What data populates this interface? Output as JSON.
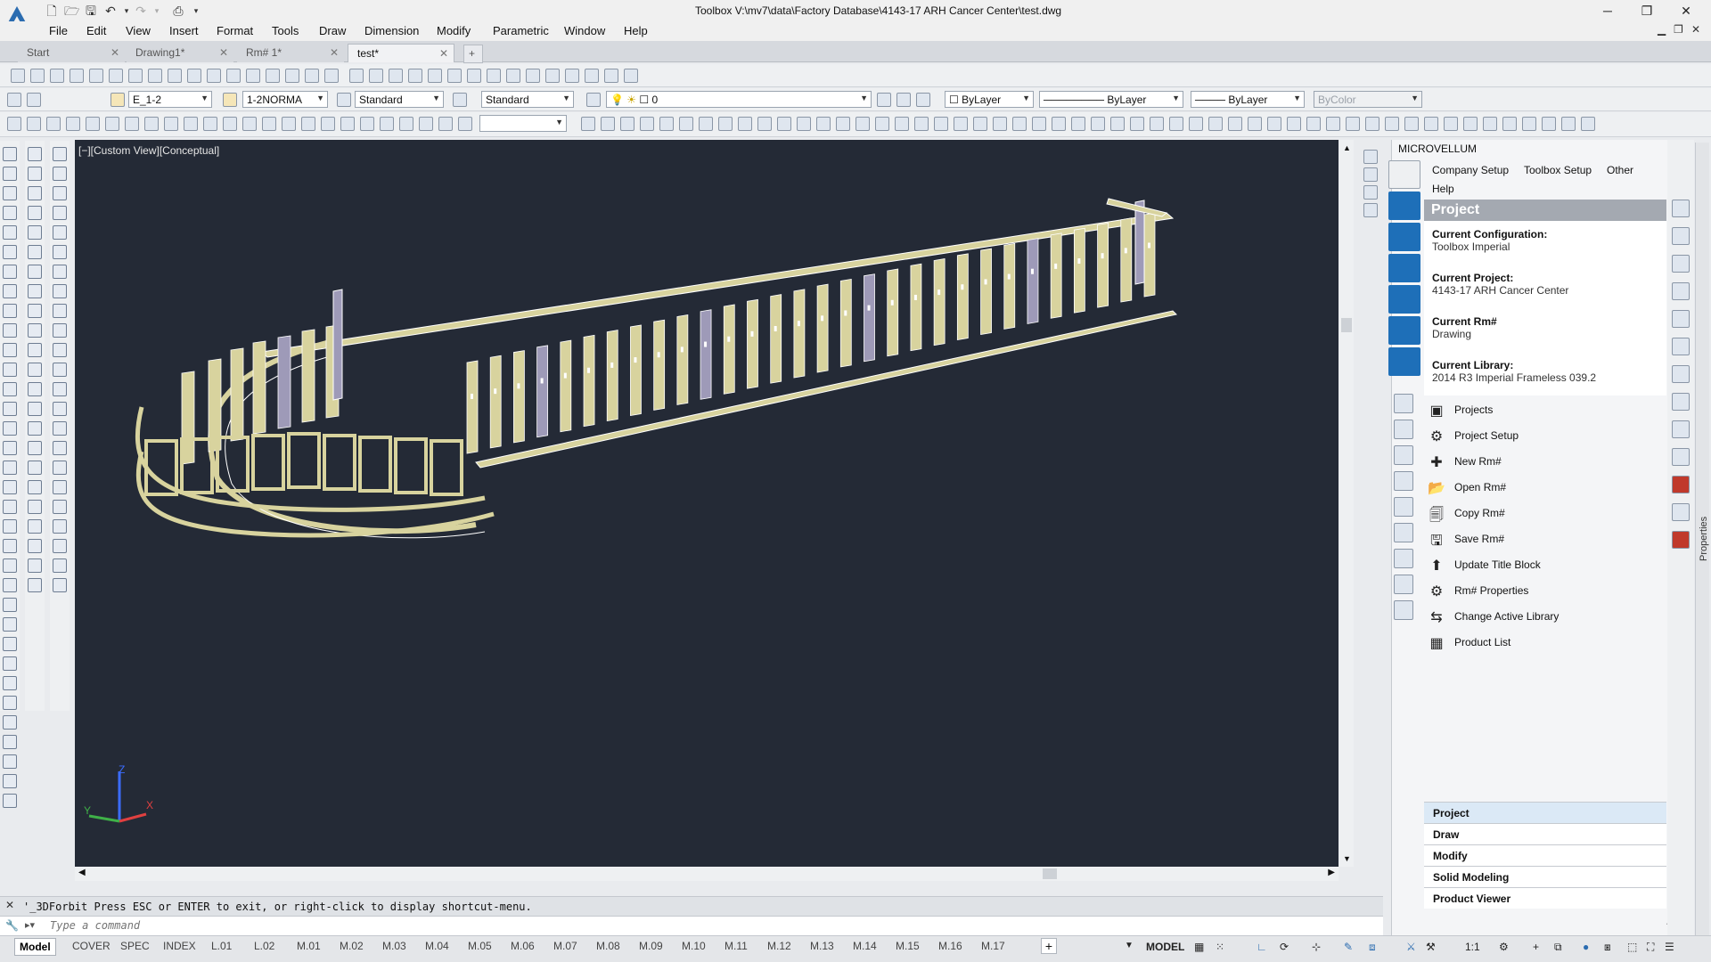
{
  "window": {
    "title": "Toolbox   V:\\mv7\\data\\Factory Database\\4143-17 ARH Cancer Center\\test.dwg",
    "minimize": "─",
    "restore": "❐",
    "close": "✕"
  },
  "menu": [
    "File",
    "Edit",
    "View",
    "Insert",
    "Format",
    "Tools",
    "Draw",
    "Dimension",
    "Modify",
    "Parametric",
    "Window",
    "Help"
  ],
  "doc_tabs": [
    {
      "label": "Start",
      "active": false
    },
    {
      "label": "Drawing1*",
      "active": false
    },
    {
      "label": "Rm# 1*",
      "active": false
    },
    {
      "label": "test*",
      "active": true
    }
  ],
  "new_tab": "+",
  "properties_bar": {
    "text_style": "E_1-2",
    "dim_style": "1-2NORMA",
    "table_style": "Standard",
    "multileader_style": "Standard",
    "layer": "0",
    "color": "ByLayer",
    "linetype": "ByLayer",
    "lineweight": "ByLayer",
    "plotstyle": "ByColor"
  },
  "viewport": {
    "label": "[−][Custom View][Conceptual]",
    "bg_color": "#242a36",
    "part_color": "#d8d39e",
    "part_shadow": "#9e9ab8"
  },
  "command": {
    "history": "'_3DForbit Press ESC or ENTER to exit, or right-click to display shortcut-menu.",
    "placeholder": "Type a command"
  },
  "layout_tabs": [
    "Model",
    "COVER",
    "SPEC",
    "INDEX",
    "L.01",
    "L.02",
    "M.01",
    "M.02",
    "M.03",
    "M.04",
    "M.05",
    "M.06",
    "M.07",
    "M.08",
    "M.09",
    "M.10",
    "M.11",
    "M.12",
    "M.13",
    "M.14",
    "M.15",
    "M.16",
    "M.17"
  ],
  "status": {
    "space": "MODEL",
    "scale": "1:1"
  },
  "side_panel": {
    "title": "MICROVELLUM",
    "menu": [
      "Company Setup",
      "Toolbox Setup",
      "Other",
      "Help"
    ],
    "section": "Project",
    "info": [
      {
        "label": "Current Configuration:",
        "value": "Toolbox Imperial"
      },
      {
        "label": "Current Project:",
        "value": "4143-17 ARH Cancer Center"
      },
      {
        "label": "Current Rm#",
        "value": "Drawing"
      },
      {
        "label": "Current Library:",
        "value": "2014 R3 Imperial Frameless 039.2"
      }
    ],
    "actions": [
      {
        "label": "Projects",
        "icon": "projects-icon"
      },
      {
        "label": "Project Setup",
        "icon": "gear-icon"
      },
      {
        "label": "New Rm#",
        "icon": "plus-icon"
      },
      {
        "label": "Open Rm#",
        "icon": "folder-open-icon"
      },
      {
        "label": "Copy Rm#",
        "icon": "copy-icon"
      },
      {
        "label": "Save Rm#",
        "icon": "save-icon"
      },
      {
        "label": "Update Title Block",
        "icon": "title-block-icon"
      },
      {
        "label": "Rm# Properties",
        "icon": "gear-icon"
      },
      {
        "label": "Change Active Library",
        "icon": "swap-icon"
      },
      {
        "label": "Product List",
        "icon": "grid-icon"
      }
    ],
    "bottom_tabs": [
      {
        "label": "Project",
        "active": true
      },
      {
        "label": "Draw",
        "active": false
      },
      {
        "label": "Modify",
        "active": false
      },
      {
        "label": "Solid Modeling",
        "active": false
      },
      {
        "label": "Product Viewer",
        "active": false
      }
    ],
    "properties_tab": "Properties"
  },
  "axis": {
    "x": "X",
    "y": "Y",
    "z": "Z"
  }
}
